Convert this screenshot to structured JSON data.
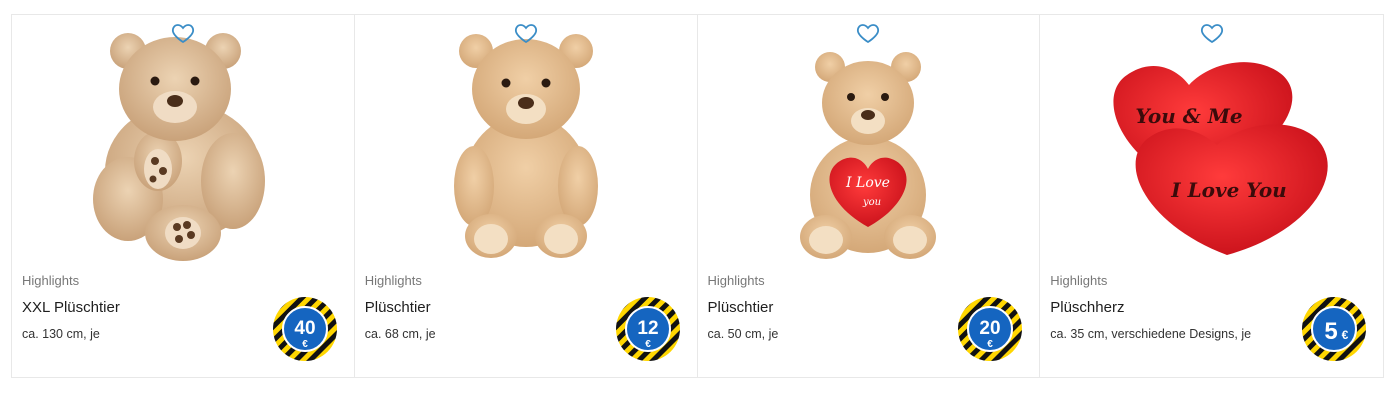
{
  "products": [
    {
      "category": "Highlights",
      "title": "XXL Plüschtier",
      "description": "ca. 130 cm, je",
      "price": "40",
      "currency": "€",
      "image": "teddy-bear-xxl"
    },
    {
      "category": "Highlights",
      "title": "Plüschtier",
      "description": "ca. 68 cm, je",
      "price": "12",
      "currency": "€",
      "image": "teddy-bear"
    },
    {
      "category": "Highlights",
      "title": "Plüschtier",
      "description": "ca. 50 cm, je",
      "price": "20",
      "currency": "€",
      "image": "teddy-bear-with-heart",
      "image_text": [
        "I Love",
        "you"
      ]
    },
    {
      "category": "Highlights",
      "title": "Plüschherz",
      "description": "ca. 35 cm, verschiedene Designs, je",
      "price": "5",
      "currency": "€",
      "image": "plush-hearts",
      "image_text": [
        "You & Me",
        "I Love You"
      ]
    }
  ],
  "colors": {
    "heart_icon": "#3a8dc7",
    "badge_blue": "#1565c0",
    "badge_yellow": "#ffd600",
    "border": "#e8e8e8",
    "bear_tan": "#d9b48d",
    "plush_red": "#e3191f"
  },
  "icons": {
    "favorite": "heart-outline-icon",
    "price_badge": "striped-price-badge"
  }
}
